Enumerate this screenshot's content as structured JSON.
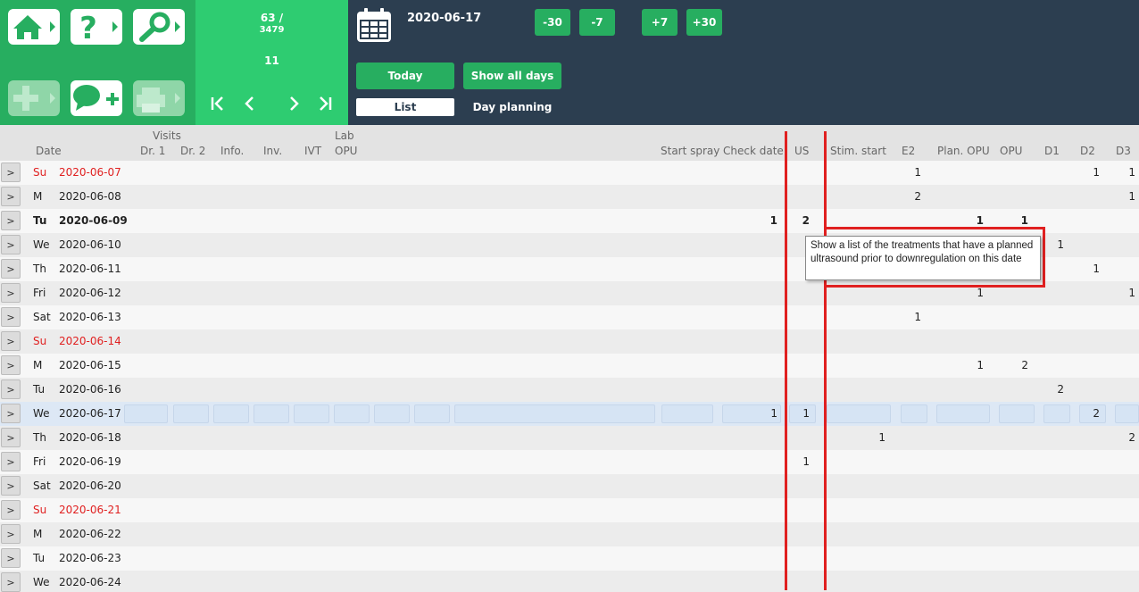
{
  "toolbar": {
    "home_icon": "home-icon",
    "help_icon": "help-icon",
    "search_icon": "search-icon",
    "add_icon": "add-icon",
    "comment_add_icon": "comment-add-icon",
    "print_icon": "print-icon"
  },
  "navigator": {
    "position": "63 /",
    "total": "3479",
    "page": "11"
  },
  "header": {
    "current_date": "2020-06-17",
    "jump_buttons": [
      "-30",
      "-7",
      "+7",
      "+30"
    ],
    "today_label": "Today",
    "show_all_label": "Show all days",
    "tabs": [
      "List",
      "Day planning"
    ]
  },
  "columns": {
    "group_visits": "Visits",
    "group_lab": "Lab",
    "date": "Date",
    "dr1": "Dr. 1",
    "dr2": "Dr. 2",
    "info": "Info.",
    "inv": "Inv.",
    "ivt": "IVT",
    "opu_lab": "OPU",
    "start_spray": "Start spray",
    "check_date": "Check date",
    "us": "US",
    "stim_start": "Stim. start",
    "e2": "E2",
    "plan_opu": "Plan. OPU",
    "opu": "OPU",
    "d1": "D1",
    "d2": "D2",
    "d3": "D3"
  },
  "rows": [
    {
      "wd": "Su",
      "date": "2020-06-07",
      "e2": "1",
      "d2": "1",
      "d3": "1"
    },
    {
      "wd": "M",
      "date": "2020-06-08",
      "e2": "2",
      "d3": "1"
    },
    {
      "wd": "Tu",
      "date": "2020-06-09",
      "check": "1",
      "us": "2",
      "plan_opu": "1",
      "opu": "1"
    },
    {
      "wd": "We",
      "date": "2020-06-10",
      "d1": "1"
    },
    {
      "wd": "Th",
      "date": "2020-06-11",
      "d2": "1"
    },
    {
      "wd": "Fri",
      "date": "2020-06-12",
      "plan_opu": "1",
      "d3": "1"
    },
    {
      "wd": "Sat",
      "date": "2020-06-13",
      "e2": "1"
    },
    {
      "wd": "Su",
      "date": "2020-06-14"
    },
    {
      "wd": "M",
      "date": "2020-06-15",
      "plan_opu": "1",
      "opu": "2"
    },
    {
      "wd": "Tu",
      "date": "2020-06-16",
      "d1": "2"
    },
    {
      "wd": "We",
      "date": "2020-06-17",
      "check": "1",
      "us": "1",
      "d2": "2"
    },
    {
      "wd": "Th",
      "date": "2020-06-18",
      "stim": "1",
      "d3": "2"
    },
    {
      "wd": "Fri",
      "date": "2020-06-19",
      "us": "1"
    },
    {
      "wd": "Sat",
      "date": "2020-06-20"
    },
    {
      "wd": "Su",
      "date": "2020-06-21"
    },
    {
      "wd": "M",
      "date": "2020-06-22"
    },
    {
      "wd": "Tu",
      "date": "2020-06-23"
    },
    {
      "wd": "We",
      "date": "2020-06-24"
    }
  ],
  "row_button_label": ">",
  "tooltip": "Show a list of the treatments that have a planned ultrasound prior to downregulation on this date",
  "colors": {
    "green_dark": "#27ae60",
    "green_light": "#2ecc71",
    "navy": "#2c3e50",
    "sunday_red": "#e02020",
    "annotation_red": "#e02020"
  }
}
